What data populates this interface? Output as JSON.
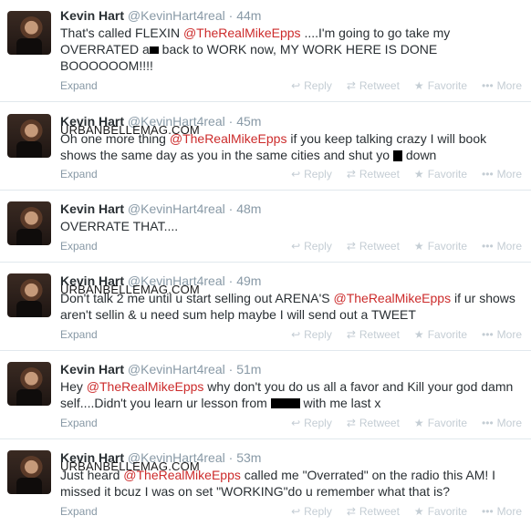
{
  "tweets": [
    {
      "name": "Kevin Hart",
      "handle": "@KevinHart4real",
      "sep": "·",
      "time": "44m",
      "text_a": "That's called FLEXIN ",
      "mention": "@TheRealMikeEpps",
      "text_b": " ....I'm going to go take my OVERRATED a",
      "text_c": " back to WORK now, MY WORK HERE IS DONE BOOOOOOM!!!!",
      "expand": "Expand"
    },
    {
      "name": "Kevin Hart",
      "handle": "@KevinHart4real",
      "sep": "·",
      "time": "45m",
      "watermark": "URBANBELLEMAG.COM",
      "text_a": "Oh one more thing ",
      "mention": "@TheRealMikeEpps",
      "text_b": " if you keep talking crazy I will book shows the same day as you in the same cities and shut yo ",
      "text_c": " down",
      "expand": "Expand"
    },
    {
      "name": "Kevin Hart",
      "handle": "@KevinHart4real",
      "sep": "·",
      "time": "48m",
      "text_a": "OVERRATE THAT....",
      "expand": "Expand"
    },
    {
      "name": "Kevin Hart",
      "handle": "@KevinHart4real",
      "sep": "·",
      "time": "49m",
      "watermark": "URBANBELLEMAG.COM",
      "text_a": "Don't talk 2 me until u start selling out ARENA'S ",
      "mention": "@TheRealMikeEpps",
      "text_b": " if ur shows aren't sellin & u need sum help maybe I will send out a TWEET",
      "expand": "Expand"
    },
    {
      "name": "Kevin Hart",
      "handle": "@KevinHart4real",
      "sep": "·",
      "time": "51m",
      "text_a": "Hey ",
      "mention": "@TheRealMikeEpps",
      "text_b": " why don't you do us all a favor and Kill your god damn self....Didn't you learn ur lesson from ",
      "text_c": " with me last x",
      "expand": "Expand"
    },
    {
      "name": "Kevin Hart",
      "handle": "@KevinHart4real",
      "sep": "·",
      "time": "53m",
      "watermark": "URBANBELLEMAG.COM",
      "text_a": "Just heard ",
      "mention": "@TheRealMikeEpps",
      "text_b": " called me \"Overrated\" on the radio this AM! I missed it bcuz I was on set \"WORKING\"do u remember what that is?",
      "expand": "Expand"
    }
  ],
  "actions": {
    "reply": "Reply",
    "retweet": "Retweet",
    "favorite": "Favorite",
    "more": "More",
    "reply_icon": "reply-arrow-icon",
    "retweet_icon": "retweet-arrows-icon",
    "favorite_icon": "star-icon",
    "more_icon": "dots-icon"
  },
  "colors": {
    "mention": "#cc2b2b",
    "muted": "#8899a6",
    "action": "#c4cdd4",
    "divider": "#e1e8ed"
  }
}
